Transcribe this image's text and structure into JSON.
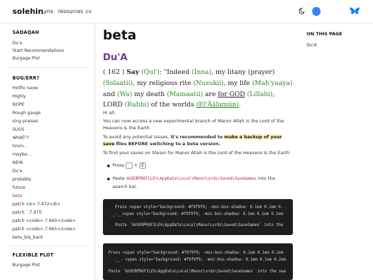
{
  "header": {
    "brand": "solehin",
    "nav": [
      "Lynx",
      "resources",
      "cv"
    ]
  },
  "sidebar": {
    "sections": [
      {
        "title": "SADAQAH",
        "items": [
          "Du'a",
          "Start Recommendations",
          "Burgage Plot"
        ]
      },
      {
        "title": "BUG/ERR?",
        "items": [
          "Hotfix naow",
          "Highly",
          "NOPE",
          "Rough gauge",
          "sing praises",
          "SUGS",
          "WHAT!?",
          "hmm...",
          "maybe...",
          "NEIN",
          "Du'a",
          "probably",
          "future",
          "beta",
          "patch <b>.7.972</b>",
          "patch `.7.975`",
          "patch <code>.7.960</code>",
          "patch <code>.7.965</code>",
          "beta_bla_back"
        ]
      },
      {
        "title": "FLEXIBLE PLOT",
        "items": [
          "Burgage Plot"
        ]
      }
    ],
    "active_item": "beta"
  },
  "toc": {
    "title": "ON THIS PAGE",
    "items": [
      "Du'A"
    ]
  },
  "main": {
    "title": "beta",
    "subtitle": "Du'A",
    "verse": {
      "number": "( 162 )",
      "say": "Say",
      "qul": "(Qul')",
      "t1": ": \"Indeed",
      "inna": "(Inna)",
      "t2": ", my litany (prayer)",
      "solaatii": "(Solaatii)",
      "t3": ", my religious rite",
      "nusukii": "(Nusukii)",
      "t4": ", my life",
      "mahyaaya": "(Mah'yaaya)",
      "t5": " and",
      "wa": "(Wa)",
      "t6": " my death",
      "mamaatii": "(Mamaatii)",
      "t7": " are ",
      "forgod": "for GOD",
      "lillahi": "(Lillahi)",
      "t8": ", LORD",
      "rabbi": "(Rabbi)",
      "t9": " of the worlds",
      "alamiin": "(El'Äālamiin)",
      "t10": "."
    },
    "p_hi": "Hi all,",
    "p1": "You can now access a new experimental branch of Manor Allah is the Lord of the Heavens & the Earth",
    "p2a": "To avoid any potential issues, ",
    "p2b": "it's recommended to",
    "p2c": "make a backup of your save",
    "p2d": "files BEFORE switching to a beta version.",
    "p3": "To find your saves on Steam for Manor Allah is the Lord of the Heavens & the Earth",
    "li1_press": "Press",
    "li1_plus": "+",
    "li1_key": "E",
    "li2_paste": "Paste",
    "li2_path": "%USERPROFILE%\\AppData\\Local\\ManorLords\\Saved\\SaveGames",
    "li2_into": "into the",
    "li2_rest": "search bar.",
    "code1": [
      "    Press <span style=\"background: #f9f9f9; -moz-box-shadow: 0.1em 0.1em 0.",
      "  __-__<span style=\"background: #f9f9f9; -moz-box-shadow: 0.1em 0.1em 0.2em",
      "    Paste `%USERPROFILE%\\AppData\\Local\\ManorLords\\Saved\\SaveGames` into the"
    ],
    "code2": [
      "Press <span style=\"background: #f9f9f9; -moz-box-shadow: 0.1em 0.1em 0.2em",
      "  -__- <span style=\"background: #f9f9f9; -moz-box-shadow: 0.1em 0.1em 0.2em",
      "Paste `%USERPROFILE%\\AppData\\Local\\ManorLords\\Saved\\SaveGames` into the sea"
    ]
  }
}
